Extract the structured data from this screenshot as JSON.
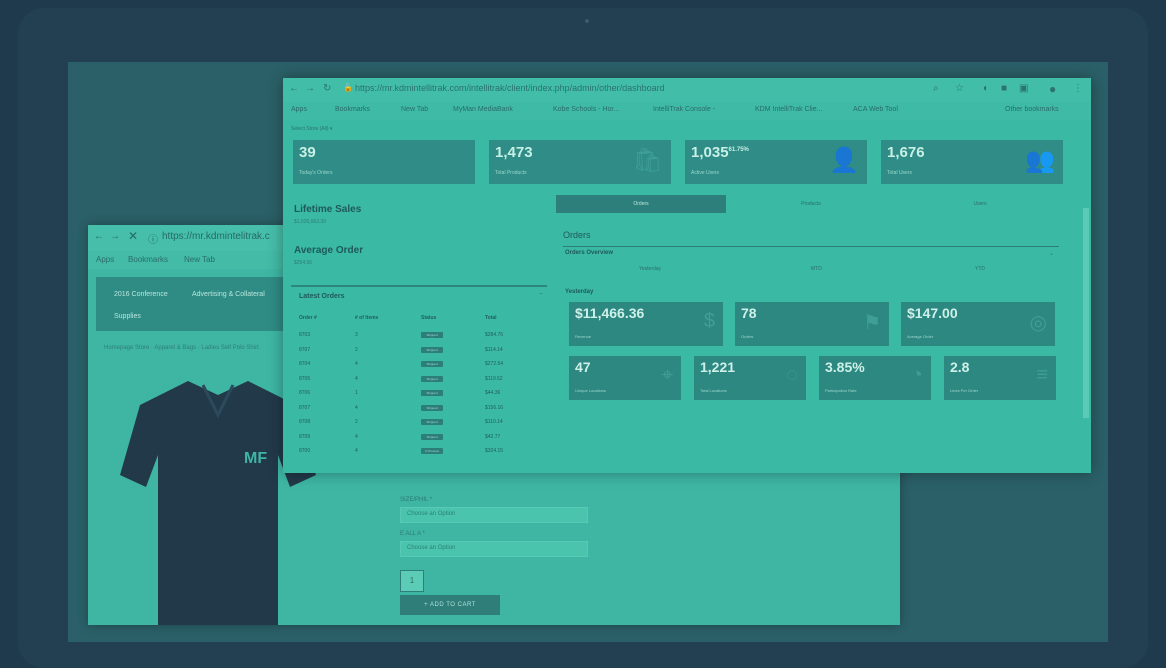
{
  "back_window": {
    "url": "https://mr.kdmintelitrak.c",
    "bookmarks": [
      "Apps",
      "Bookmarks",
      "New Tab"
    ],
    "nav": [
      "2016 Conference",
      "Advertising & Collateral",
      "Supplies"
    ],
    "breadcrumb": "Homepage Store · Apparel & Bags · Ladies Self Polo Shirt",
    "shirt_logo": "MF",
    "field1_label": "SIZE/PHIL *",
    "field1_placeholder": "Choose an Option",
    "field2_label": "E ALL A *",
    "field2_placeholder": "Choose an Option",
    "qty": "1",
    "add_to_cart": "+ ADD TO CART"
  },
  "front_window": {
    "url": "https://mr.kdmintellitrak.com/intellitrak/client/index.php/admin/other/dashboard",
    "bookmarks": [
      "Apps",
      "Bookmarks",
      "New Tab",
      "MyMan MediaBank",
      "Kobe Schools - Hor...",
      "IntelliTrak Console -",
      "KDM IntelliTrak Clie...",
      "ACA Web Tool",
      "Other bookmarks"
    ],
    "store_selector": "Select Store (All) ▾",
    "stats": [
      {
        "value": "39",
        "label": "Today's Orders"
      },
      {
        "value": "1,473",
        "label": "Total Products"
      },
      {
        "value": "1,035",
        "sup": "61.75%",
        "label": "Active Users"
      },
      {
        "value": "1,676",
        "label": "Total Users"
      }
    ],
    "lifetime_sales": {
      "title": "Lifetime Sales",
      "value": "$1,526,063.30"
    },
    "average_order": {
      "title": "Average Order",
      "value": "$254.56"
    },
    "latest_orders": {
      "title": "Latest Orders",
      "headers": [
        "Order #",
        "# of Items",
        "Status",
        "Total"
      ],
      "rows": [
        {
          "order": "8703",
          "items": "3",
          "status": "Shipped",
          "total": "$284.76"
        },
        {
          "order": "8707",
          "items": "2",
          "status": "Shipped",
          "total": "$114.14"
        },
        {
          "order": "8704",
          "items": "4",
          "status": "Shipped",
          "total": "$272.54"
        },
        {
          "order": "8705",
          "items": "4",
          "status": "Shipped",
          "total": "$119.52"
        },
        {
          "order": "8706",
          "items": "1",
          "status": "Shipped",
          "total": "$44.36"
        },
        {
          "order": "8707",
          "items": "4",
          "status": "Shipped",
          "total": "$156.16"
        },
        {
          "order": "8708",
          "items": "2",
          "status": "Shipped",
          "total": "$110.14"
        },
        {
          "order": "8709",
          "items": "4",
          "status": "Shipped",
          "total": "$42.77"
        },
        {
          "order": "8700",
          "items": "4",
          "status": "In Process",
          "total": "$324.15"
        }
      ]
    },
    "tabs": [
      "Orders",
      "Products",
      "Users"
    ],
    "orders_heading": "Orders",
    "orders_overview": "Orders Overview",
    "segments": [
      "Yesterday",
      "MTD",
      "YTD"
    ],
    "yesterday": "Yesterday",
    "cards_row1": [
      {
        "value": "$11,466.36",
        "label": "Revenue"
      },
      {
        "value": "78",
        "label": "Orders"
      },
      {
        "value": "$147.00",
        "label": "Average Order"
      }
    ],
    "cards_row2": [
      {
        "value": "47",
        "label": "Unique Locations"
      },
      {
        "value": "1,221",
        "label": "Total Locations"
      },
      {
        "value": "3.85%",
        "label": "Participation Rate"
      },
      {
        "value": "2.8",
        "label": "Lines Per Order"
      }
    ]
  }
}
